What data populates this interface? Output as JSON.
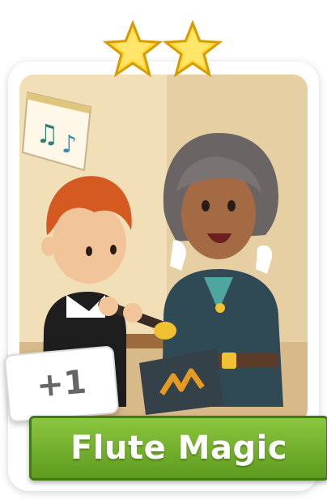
{
  "card": {
    "title": "Flute Magic",
    "count_label": "+1",
    "stars": 2,
    "banner_color": "#6fae2a",
    "star_color": "#ffd93a"
  },
  "art": {
    "subject": "boy-playing-flute-with-teacher",
    "icons": [
      "music-notes-icon",
      "star-icon"
    ]
  }
}
